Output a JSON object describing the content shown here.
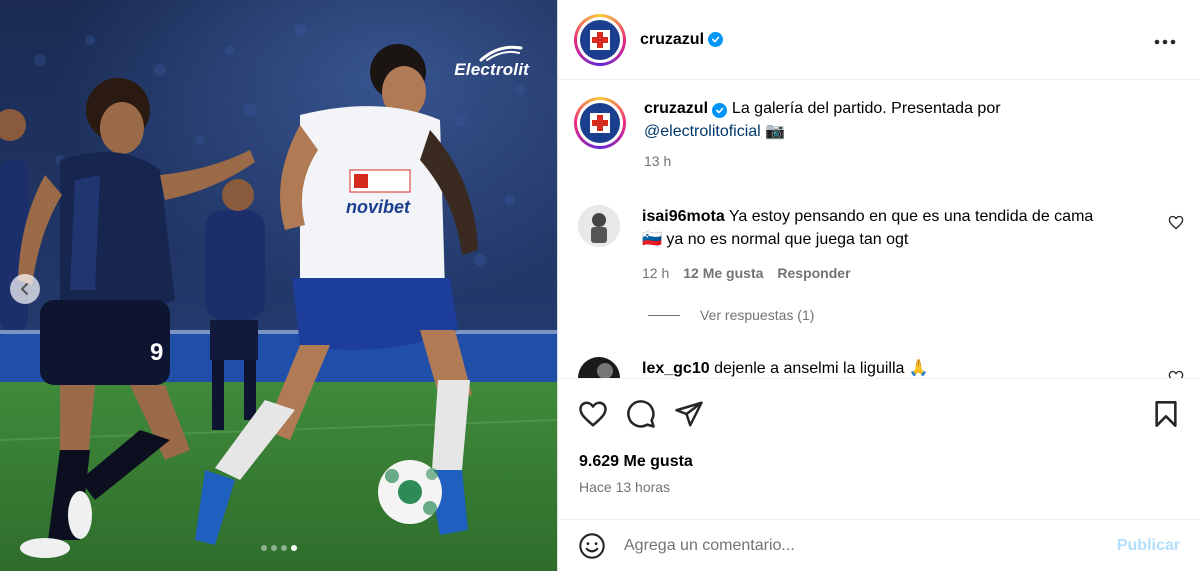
{
  "media": {
    "brand_logo_text": "Electrolit",
    "jersey_text_left": "9",
    "jersey_sponsor_right": "novibet",
    "carousel_dots": 4,
    "carousel_active_index": 3
  },
  "header": {
    "username": "cruzazul",
    "verified": true,
    "more_icon": "more-horizontal-icon"
  },
  "caption": {
    "username": "cruzazul",
    "text": "La galería del partido. Presentada por",
    "mention": "@electrolitoficial",
    "emoji": "📷",
    "time": "13 h"
  },
  "comments": [
    {
      "username": "isai96mota",
      "text_1": "Ya estoy pensando en que es una tendida de cama",
      "flag": "🇸🇮",
      "text_2": "ya no es normal que juega tan ogt",
      "time": "12 h",
      "likes": "12 Me gusta",
      "reply": "Responder"
    },
    {
      "username": "lex_gc10",
      "text": "dejenle a anselmi la liguilla",
      "emoji": "🙏"
    }
  ],
  "view_replies": "Ver respuestas (1)",
  "actions": {
    "likes": "9.629 Me gusta",
    "time_ago": "Hace 13 horas"
  },
  "composer": {
    "placeholder": "Agrega un comentario...",
    "publish": "Publicar"
  },
  "colors": {
    "accent": "#0095f6",
    "publish_disabled": "#b2dffc",
    "muted": "#737373",
    "link": "#00376b"
  }
}
